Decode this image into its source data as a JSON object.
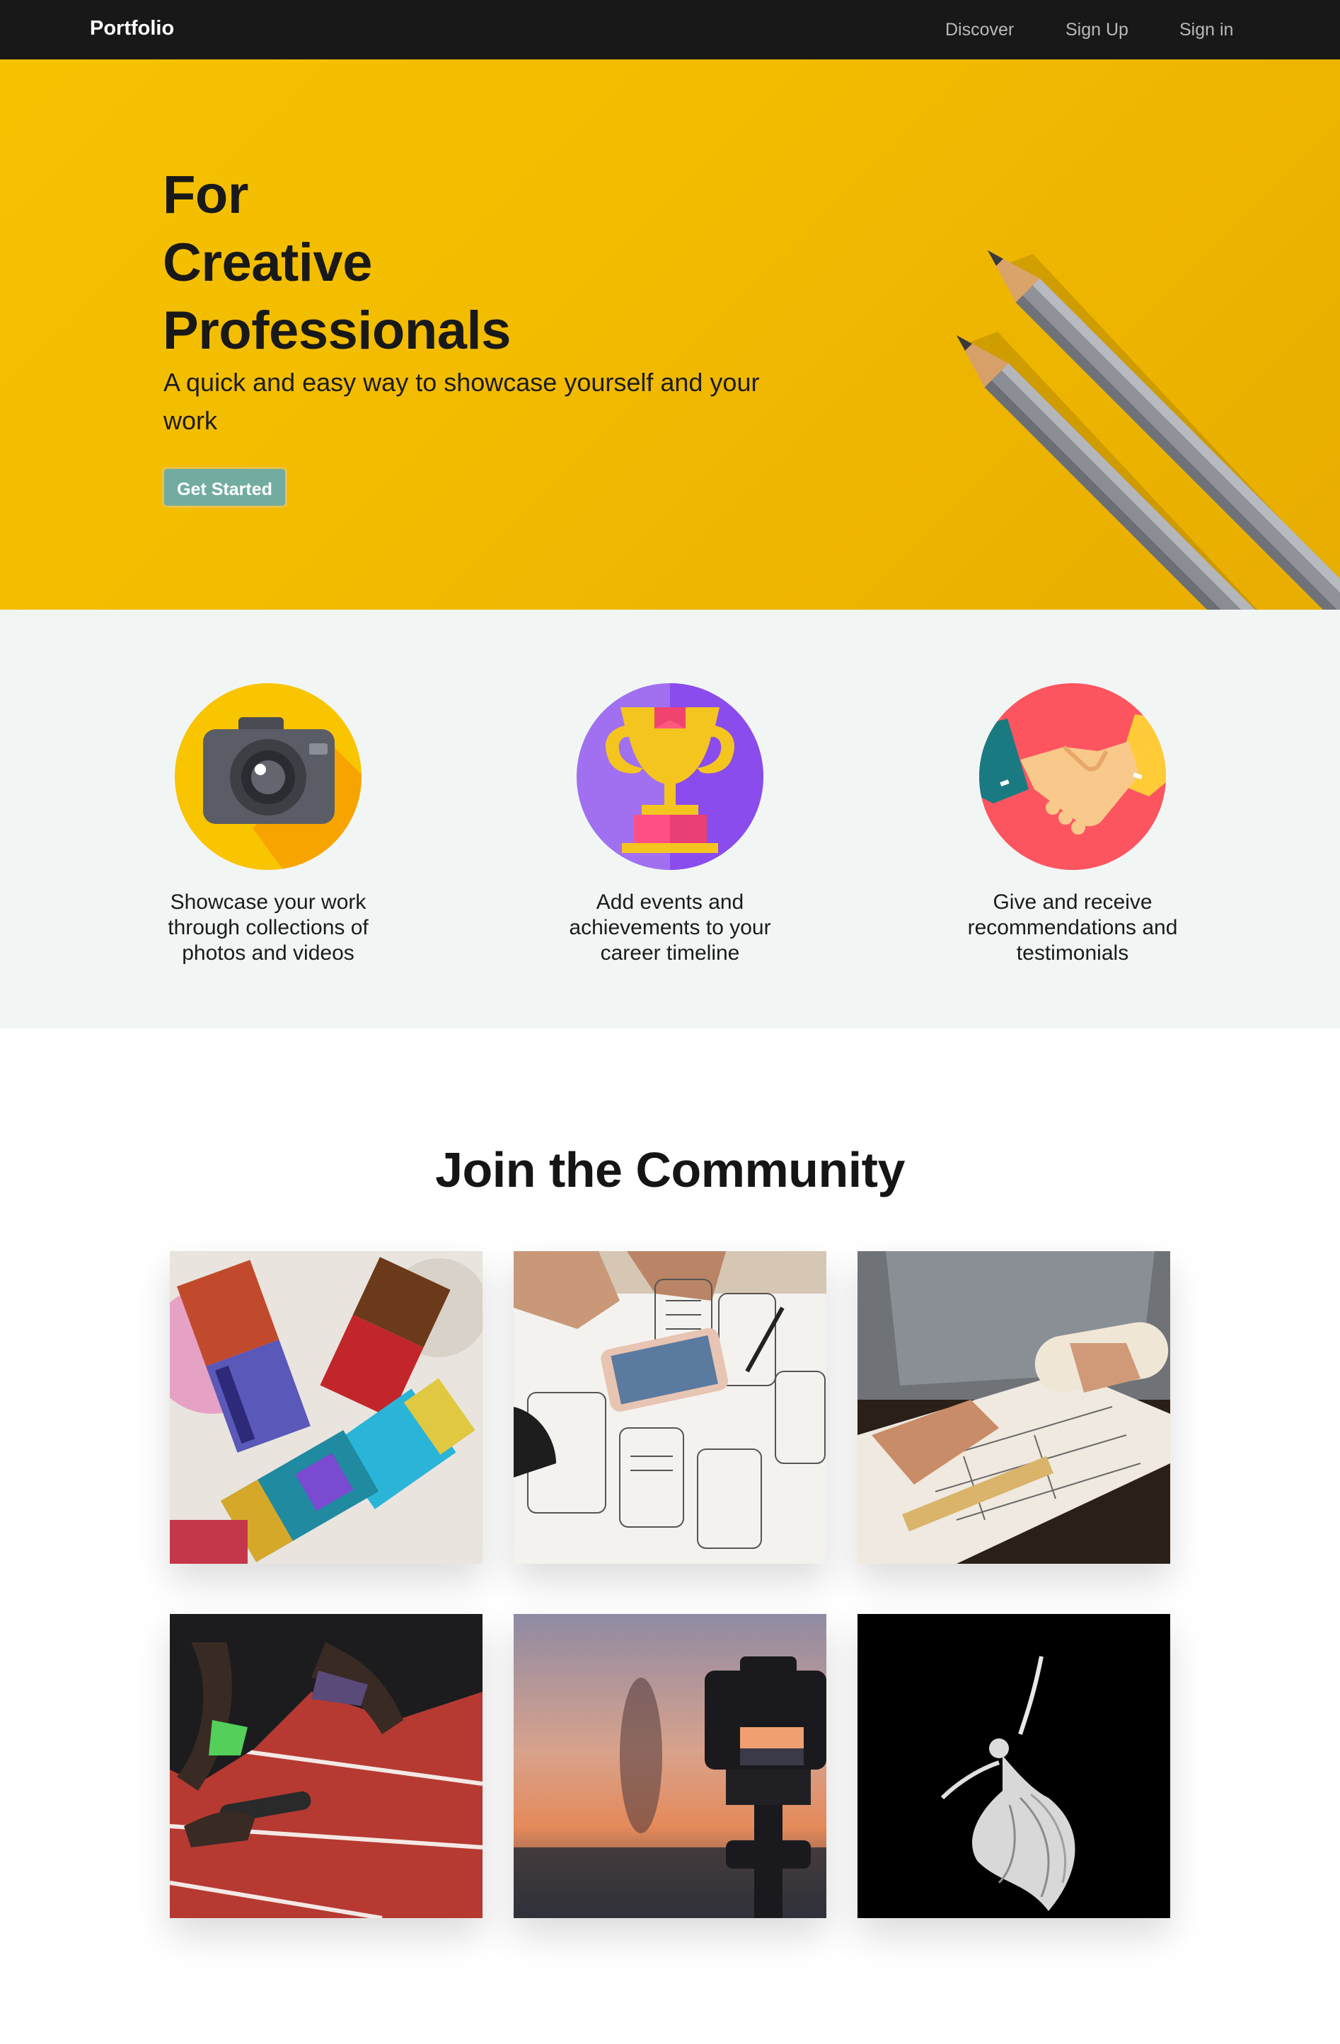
{
  "nav": {
    "brand": "Portfolio",
    "links": [
      "Discover",
      "Sign Up",
      "Sign in"
    ]
  },
  "hero": {
    "title_lines": [
      "For",
      "Creative",
      "Professionals"
    ],
    "subtitle": "A quick and easy way to showcase yourself and your work",
    "cta": "Get Started"
  },
  "features": [
    {
      "icon": "camera-icon",
      "text": "Showcase your work through collections of photos and videos"
    },
    {
      "icon": "trophy-icon",
      "text": "Add events and achievements to your career timeline"
    },
    {
      "icon": "handshake-icon",
      "text": "Give and receive recommendations and testimonials"
    }
  ],
  "community": {
    "title": "Join the Community",
    "images": [
      "paint-brushes",
      "wireframe-sketching",
      "architect-drawing",
      "sprinter-start",
      "camera-sunset",
      "ballet-dancer"
    ]
  },
  "colors": {
    "nav_bg": "#181818",
    "hero_bg": "#f4bf00",
    "cta_bg": "#72aca0",
    "features_bg": "#f1f6f4"
  }
}
